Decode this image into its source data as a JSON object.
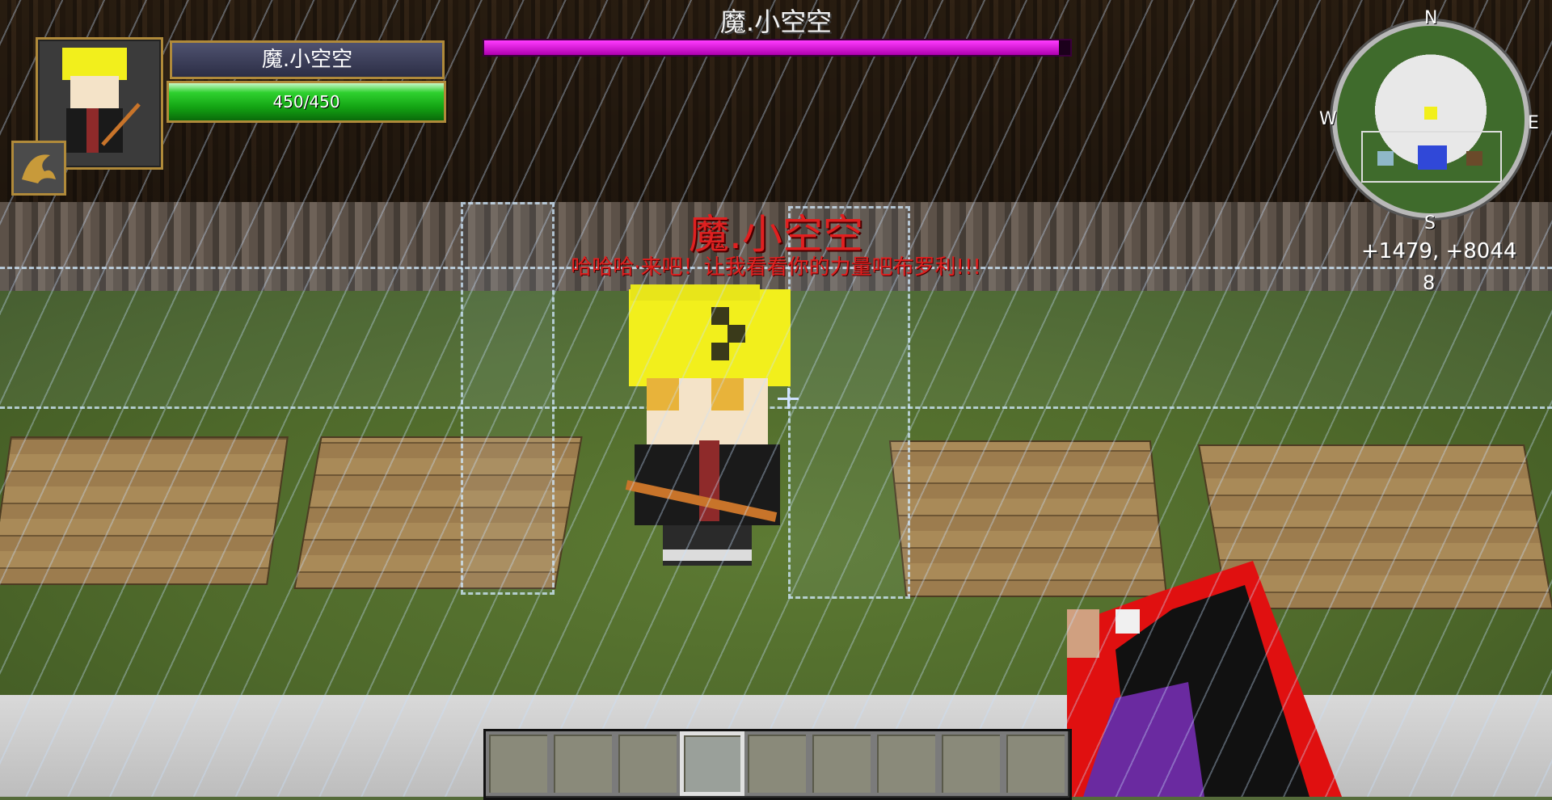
{
  "boss": {
    "name": "魔.小空空",
    "health_fraction": 0.98,
    "bar_color": "#e000e0"
  },
  "player_hud": {
    "name": "魔.小空空",
    "hp_text": "450/450",
    "hp_current": 450,
    "hp_max": 450,
    "portrait_icon": "character-portrait-icon",
    "buff_icon": "dragon-icon"
  },
  "npc": {
    "name_tag": "魔.小空空",
    "speech": "哈哈哈·来吧！让我看看你的力量吧布罗利!!!"
  },
  "minimap": {
    "north": "N",
    "south": "S",
    "east": "E",
    "west": "W"
  },
  "coords": {
    "text": "+1479, +8044",
    "level": "8"
  },
  "hotbar": {
    "slots": 9,
    "selected_index": 3
  },
  "colors": {
    "gold_frame": "#b08a3a",
    "hp_green": "#13a313",
    "npc_text": "#e02020"
  }
}
